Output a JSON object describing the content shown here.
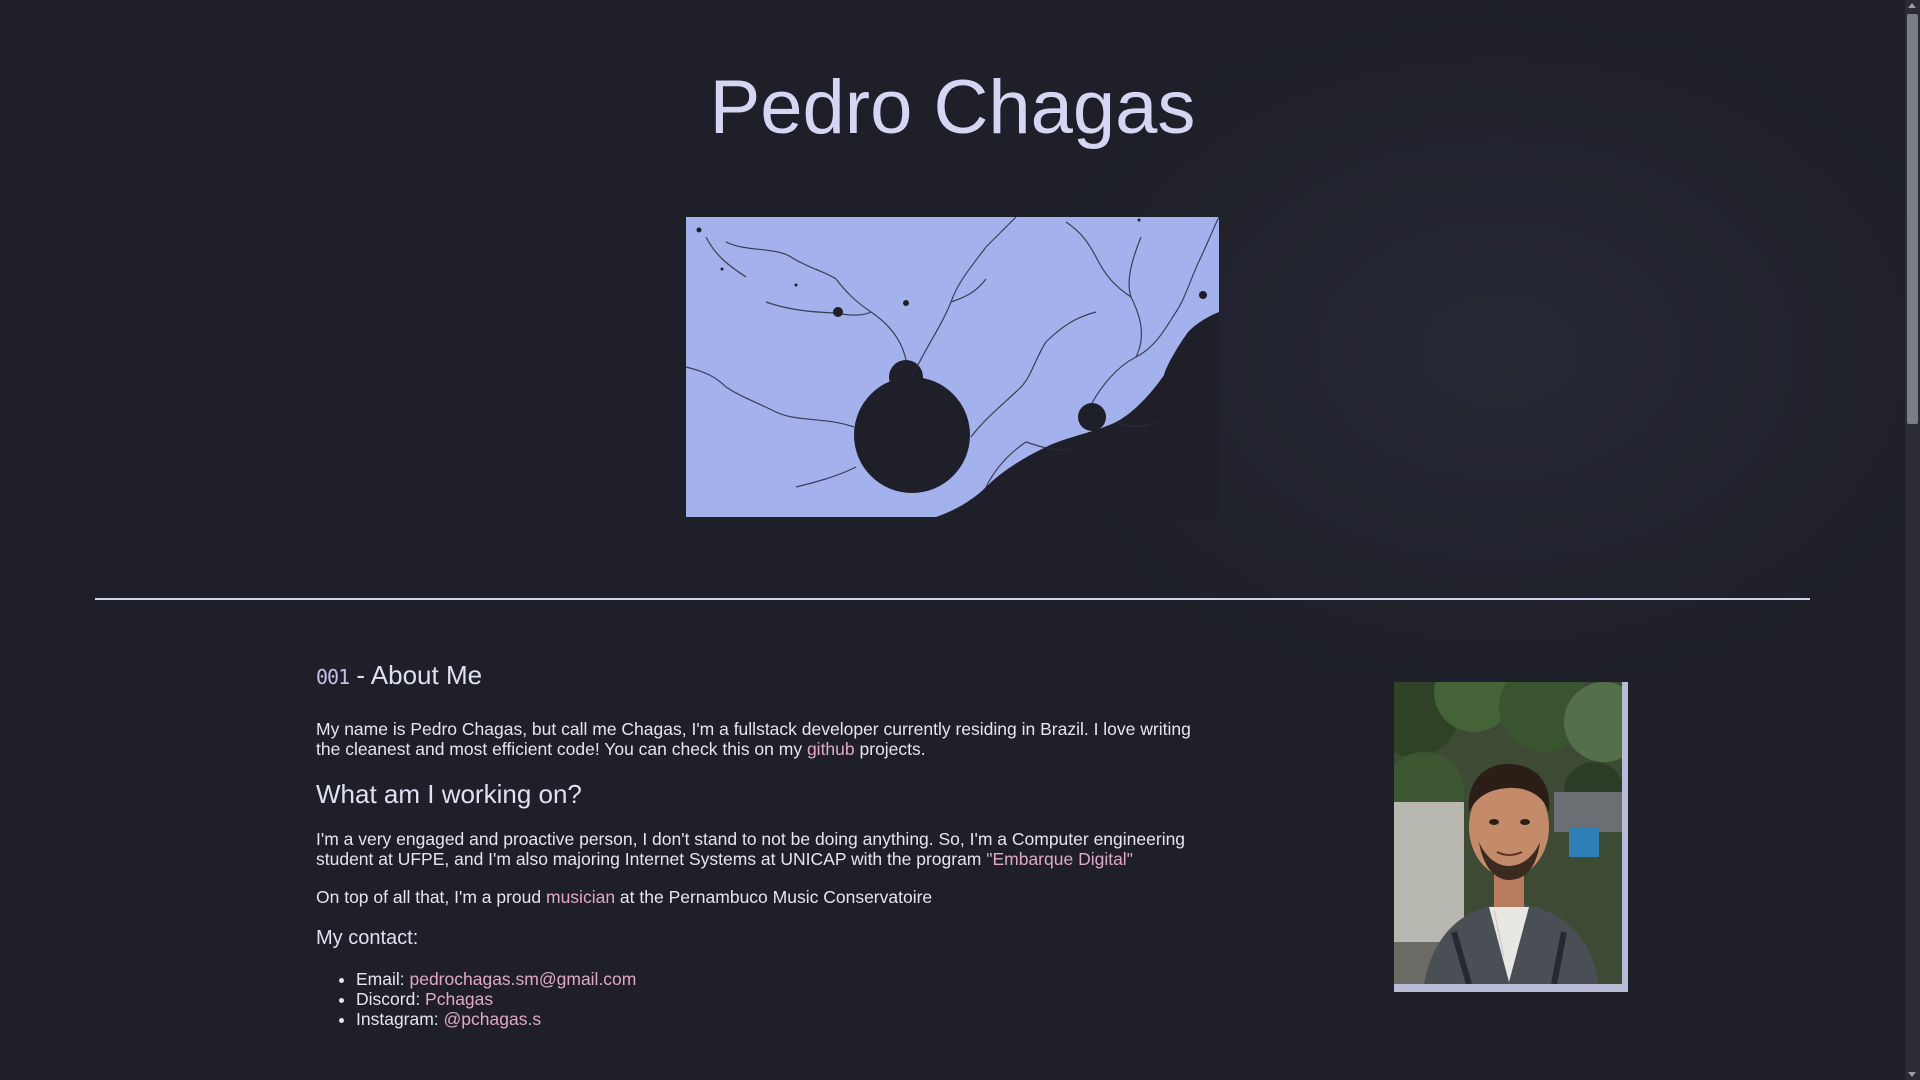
{
  "header": {
    "title": "Pedro Chagas"
  },
  "hero_image": {
    "description_icon": "mandelbrot-fractal-image",
    "color": "#a3b1ec"
  },
  "about": {
    "number": "001",
    "heading": " - About Me",
    "intro_text": "My name is Pedro Chagas, but call me Chagas, I'm a fullstack developer currently residing in Brazil. I love writing the cleanest and most efficient code! You can check this on my ",
    "github_link": "github",
    "intro_end": " projects.",
    "working_heading": "What am I working on?",
    "working_text": "I'm a very engaged and proactive person, I don't stand to not be doing anything. So, I'm a Computer engineering student at UFPE, and I'm also majoring Internet Systems at UNICAP with the program ",
    "program_link": "\"Embarque Digital\"",
    "music_pre": "On top of all that, I'm a proud ",
    "music_link": "musician",
    "music_post": " at the Pernambuco Music Conservatoire",
    "contact_heading": "My contact:",
    "contacts": [
      {
        "label": "Email: ",
        "value": "pedrochagas.sm@gmail.com"
      },
      {
        "label": "Discord: ",
        "value": "Pchagas"
      },
      {
        "label": "Instagram: ",
        "value": "@pchagas.s"
      }
    ]
  },
  "profile_photo": {
    "icon": "profile-photo"
  },
  "colors": {
    "background": "#1e1f28",
    "title": "#d4d6f4",
    "link": "#e0a8c9",
    "fractal": "#a3b1ec"
  }
}
